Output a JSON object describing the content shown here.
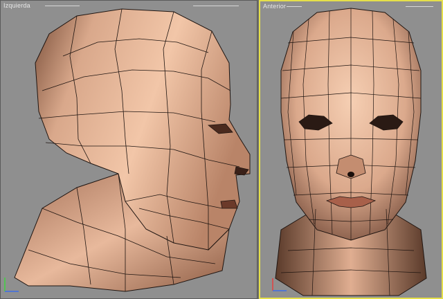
{
  "viewports": {
    "left": {
      "label": "Izquierda"
    },
    "right": {
      "label": "Anterior"
    }
  },
  "colors": {
    "viewport_bg": "#8f8f8f",
    "active_border": "#e6e04a",
    "skin": "#d8a589",
    "wire": "#1e1410"
  }
}
